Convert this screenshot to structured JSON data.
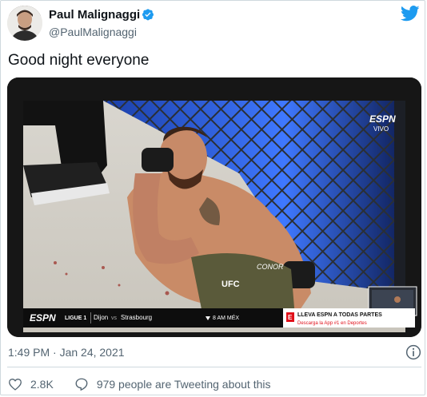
{
  "author": {
    "name": "Paul Malignaggi",
    "handle": "@PaulMalignaggi",
    "verified": true
  },
  "tweet": {
    "text": "Good night everyone",
    "timestamp": "1:49 PM · Jan 24, 2021"
  },
  "media": {
    "broadcaster": "ESPN",
    "live_badge": "VIVO",
    "ticker_network": "ESPN",
    "ticker_league": "LIGUE 1",
    "ticker_match": "Dijon",
    "ticker_vs": "vs",
    "ticker_match_away": "Strasbourg",
    "ticker_time": "8 AM MÉX",
    "promo_title": "LLEVA ESPN A TODAS PARTES",
    "promo_subtitle": "Descarga la App #1 en Deportes",
    "shorts_text": "UFC",
    "shorts_text_2": "CONOR"
  },
  "engagement": {
    "likes": "2.8K",
    "tweeting": "979 people are Tweeting about this"
  },
  "icons": {
    "avatar": "avatar",
    "verified": "verified-badge-icon",
    "bird": "twitter-bird-icon",
    "info": "info-icon",
    "like": "heart-icon",
    "reply": "speech-bubble-icon"
  },
  "colors": {
    "twitter_blue": "#1d9bf0",
    "text_secondary": "#536471",
    "espn_red": "#e0101a"
  }
}
